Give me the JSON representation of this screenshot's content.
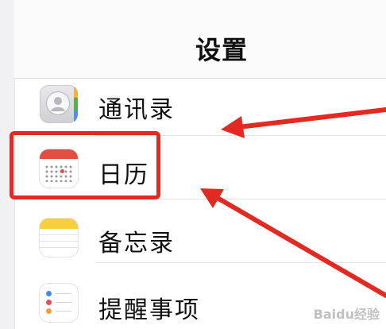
{
  "nav": {
    "title": "设置"
  },
  "settings": {
    "items": [
      {
        "label": "通讯录",
        "icon": "contacts-icon"
      },
      {
        "label": "日历",
        "icon": "calendar-icon"
      },
      {
        "label": "备忘录",
        "icon": "notes-icon"
      },
      {
        "label": "提醒事项",
        "icon": "reminders-icon"
      }
    ]
  },
  "annotation": {
    "highlight_color": "#e32a22",
    "arrow_color": "#e32a22"
  },
  "watermark": {
    "text": "Baidu经验"
  }
}
